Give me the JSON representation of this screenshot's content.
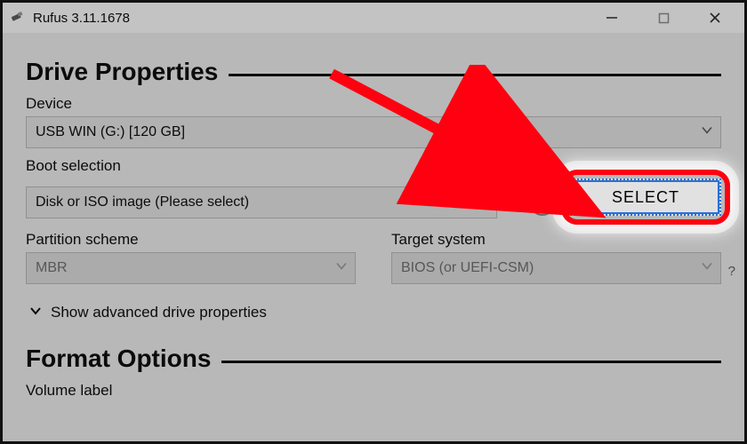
{
  "titlebar": {
    "title": "Rufus 3.11.1678"
  },
  "sections": {
    "drive_properties": {
      "heading": "Drive Properties"
    },
    "format_options": {
      "heading": "Format Options"
    }
  },
  "device": {
    "label": "Device",
    "value": "USB WIN (G:) [120 GB]"
  },
  "boot_selection": {
    "label": "Boot selection",
    "value": "Disk or ISO image (Please select)",
    "select_button": "SELECT"
  },
  "partition_scheme": {
    "label": "Partition scheme",
    "value": "MBR"
  },
  "target_system": {
    "label": "Target system",
    "value": "BIOS (or UEFI-CSM)",
    "help": "?"
  },
  "advanced_toggle": {
    "label": "Show advanced drive properties"
  },
  "volume_label": {
    "label": "Volume label"
  }
}
